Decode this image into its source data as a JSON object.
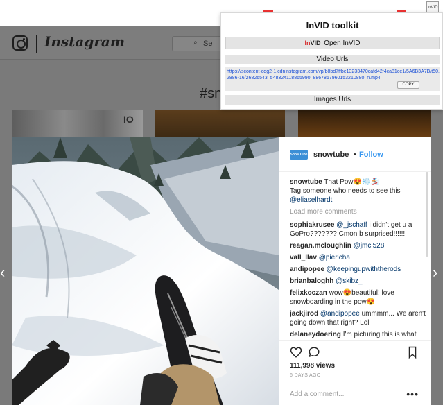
{
  "browser": {
    "extension_icon_label": "InVID"
  },
  "instagram": {
    "wordmark": "Instagram",
    "search_placeholder": "Se",
    "hashtag_title": "#sn",
    "thumbnail_text": "IO"
  },
  "post": {
    "username": "snowtube",
    "avatar_label": "SnowTube",
    "follow_separator": "•",
    "follow_label": "Follow",
    "caption": {
      "user": "snowtube",
      "text": "That Pow😍💨🏂",
      "line2": "Tag someone who needs to see this",
      "mention": "@eliaselhardt"
    },
    "load_more": "Load more comments",
    "comments": [
      {
        "user": "sophiakrusee",
        "mention": "@_jschaff",
        "text": "i didn't get u a GoPro??????? Cmon b surprised!!!!!!"
      },
      {
        "user": "reagan.mcloughlin",
        "mention": "@jmcl528",
        "text": ""
      },
      {
        "user": "vall_llav",
        "mention": "@piericha",
        "text": ""
      },
      {
        "user": "andipopee",
        "mention": "@keepingupwiththerods",
        "text": ""
      },
      {
        "user": "brianbaloghh",
        "mention": "@skibz_",
        "text": ""
      },
      {
        "user": "felixkoczan",
        "mention": "",
        "text": "wow😍beautiful! love snowboarding in the pow😍"
      },
      {
        "user": "jackjirod",
        "mention": "@andipopee",
        "text": "ummmm... We aren't going down that right? Lol"
      },
      {
        "user": "delaneydoering",
        "mention": "",
        "text": "I'm picturing this is what your film looks like except upside down 😂@kyleninnemann"
      }
    ],
    "views": "111,998 views",
    "date": "6 DAYS AGO",
    "add_comment_placeholder": "Add a comment...",
    "more_label": "•••"
  },
  "invid": {
    "title": "InVID toolkit",
    "open_label": "Open InVID",
    "logo_in": "In",
    "logo_vid": "VID",
    "video_urls_header": "Video Urls",
    "video_url": "https://scontent-cdg2-1.cdninstagram.com/vp/b8bd7ffbe13233470cafd42f4ca81ce1/5A6B3A7B/t50.2886-16/26826543_548324118865990_886786796015321088​0_n.mp4",
    "copy_label": "COPY",
    "images_urls_header": "Images Urls"
  },
  "navigation": {
    "prev_arrow": "‹",
    "next_arrow": "›"
  }
}
